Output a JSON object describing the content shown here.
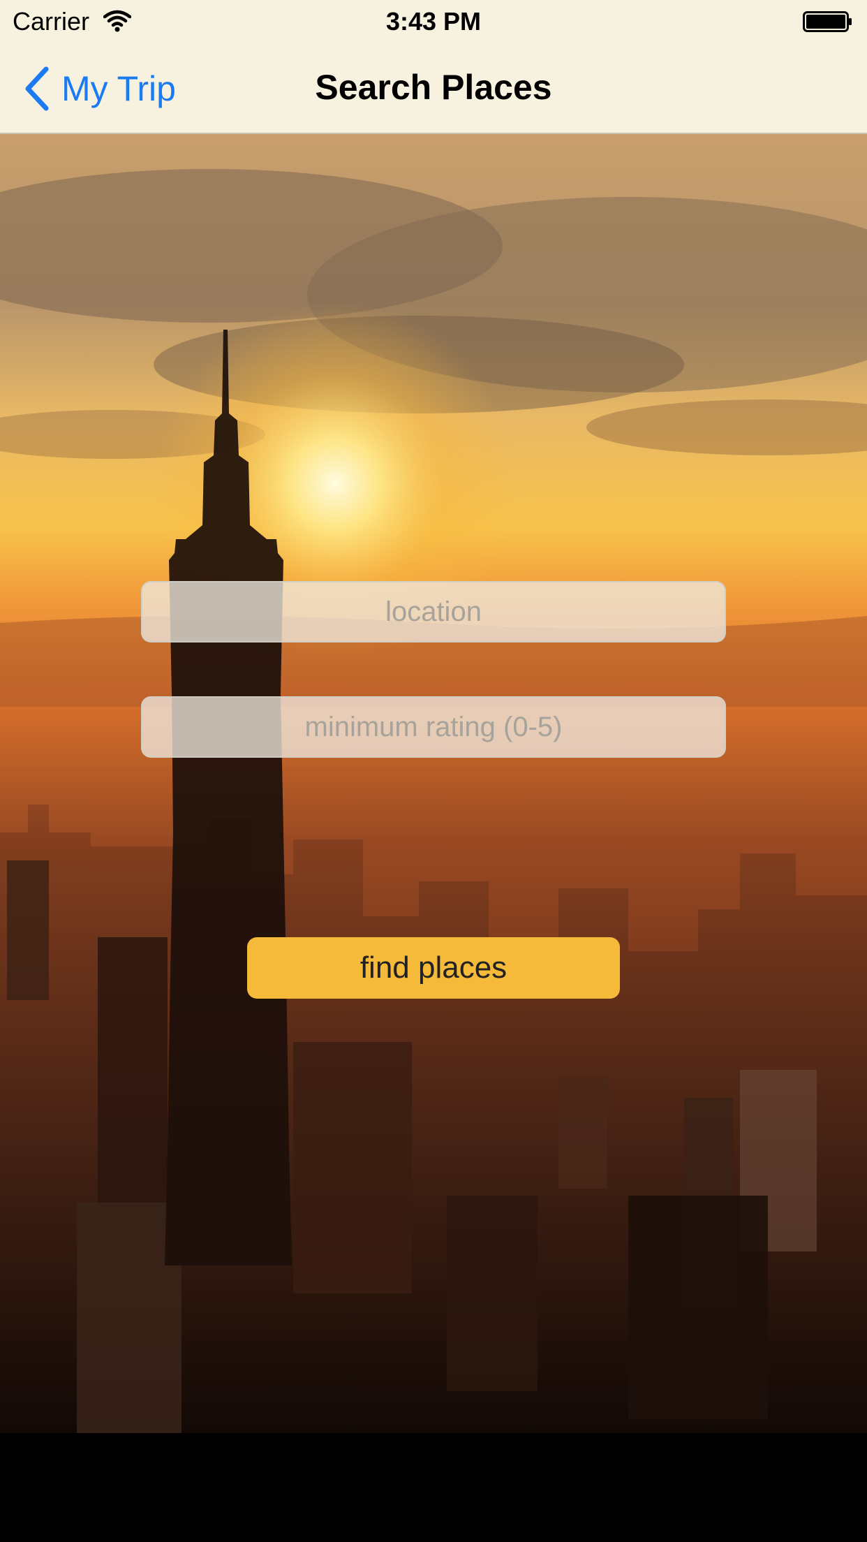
{
  "status_bar": {
    "carrier": "Carrier",
    "time": "3:43 PM"
  },
  "nav": {
    "back_label": "My Trip",
    "title": "Search Places"
  },
  "form": {
    "location_placeholder": "location",
    "rating_placeholder": "minimum rating (0-5)",
    "submit_label": "find places"
  },
  "colors": {
    "nav_bg": "#f7f2df",
    "link": "#1a7bf2",
    "button": "#f6ba3a"
  }
}
